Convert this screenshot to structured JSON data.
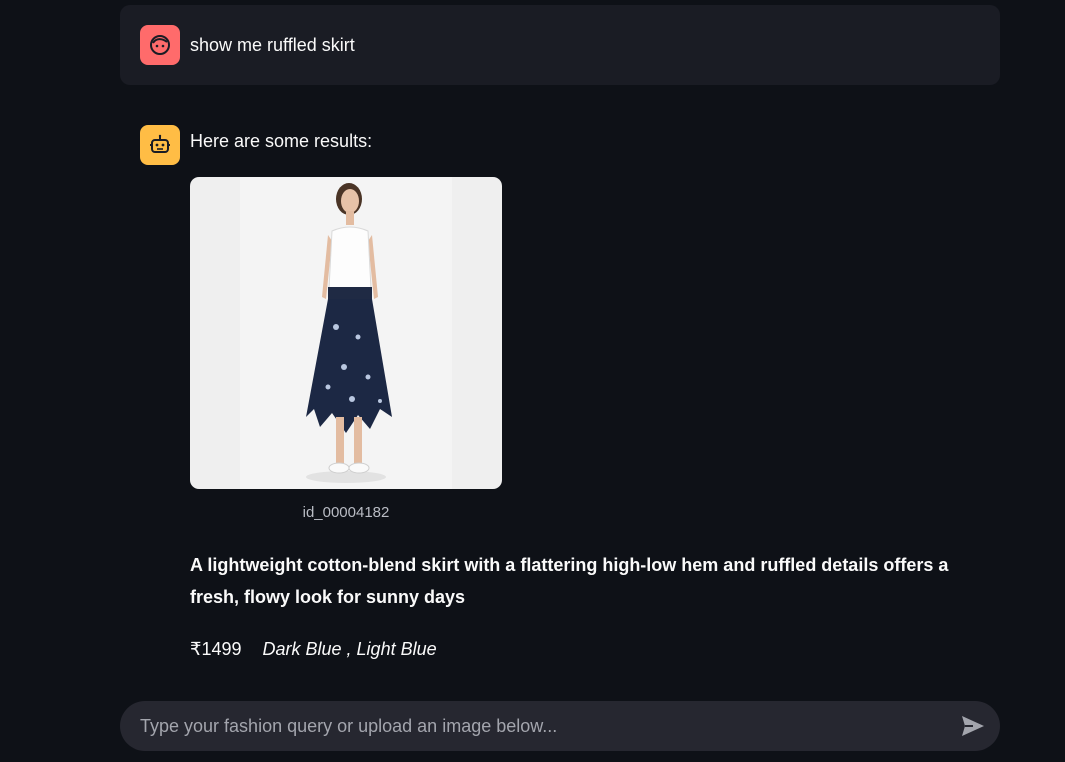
{
  "user_message": {
    "avatar_icon": "user-face-icon",
    "avatar_color": "#ff6b6b",
    "text": "show me ruffled skirt"
  },
  "assistant_message": {
    "avatar_icon": "robot-icon",
    "avatar_color": "#ffbd45",
    "intro": "Here are some results:",
    "product": {
      "image": "woman-in-ruffled-skirt-photo",
      "id": "id_00004182",
      "description": "A lightweight cotton-blend skirt with a flattering high-low hem and ruffled details offers a fresh, flowy look for sunny days",
      "price": "₹1499",
      "colors": "Dark Blue , Light Blue"
    }
  },
  "chat_input": {
    "placeholder": "Type your fashion query or upload an image below...",
    "value": "",
    "send_icon": "send-icon"
  }
}
